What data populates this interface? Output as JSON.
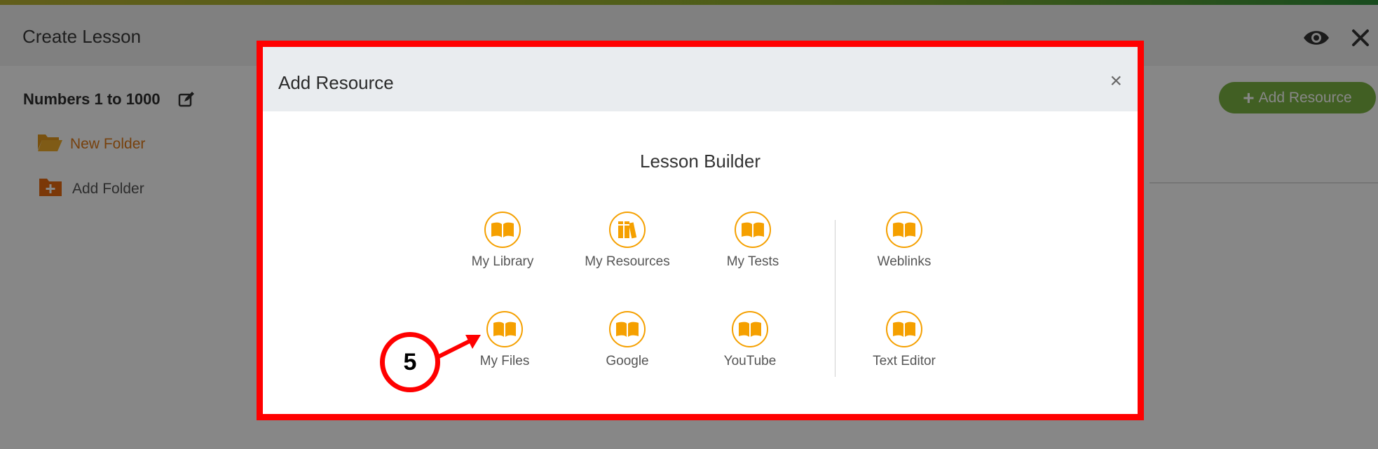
{
  "background": {
    "header": {
      "title": "Create Lesson"
    },
    "sidebar": {
      "lesson_name": "Numbers 1 to 1000",
      "items": [
        {
          "label": "New Folder"
        },
        {
          "label": "Add Folder"
        }
      ]
    },
    "add_resource_button": {
      "label": "Add Resource"
    }
  },
  "modal": {
    "title": "Add Resource",
    "close_symbol": "×",
    "section_title": "Lesson Builder",
    "tiles": [
      {
        "label": "My Library",
        "icon": "book-icon"
      },
      {
        "label": "My Resources",
        "icon": "books-icon"
      },
      {
        "label": "My Tests",
        "icon": "book-icon"
      },
      {
        "label": "Weblinks",
        "icon": "book-icon"
      },
      {
        "label": "My Files",
        "icon": "book-icon"
      },
      {
        "label": "Google",
        "icon": "book-icon"
      },
      {
        "label": "YouTube",
        "icon": "book-icon"
      },
      {
        "label": "Text Editor",
        "icon": "book-icon"
      }
    ]
  },
  "annotation": {
    "step": "5"
  },
  "colors": {
    "accent_orange": "#f5a000",
    "folder_orange": "#e07b1a",
    "button_green": "#7cb342",
    "highlight_red": "#ff0000"
  }
}
